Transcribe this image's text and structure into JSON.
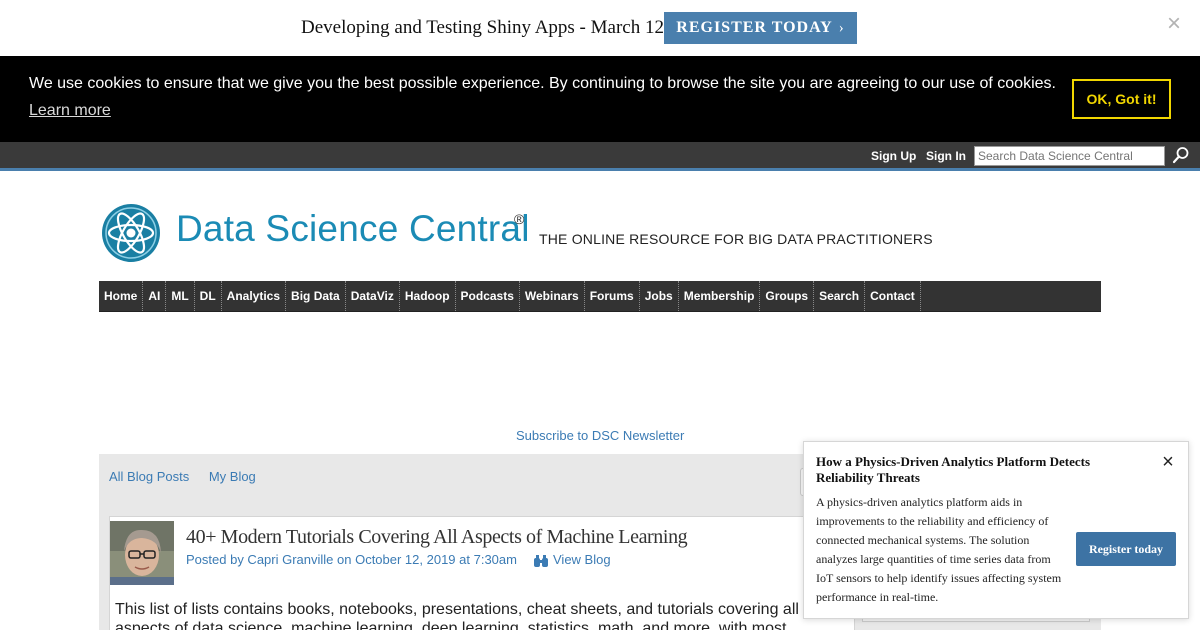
{
  "promo_banner": {
    "text": "Developing and Testing Shiny Apps - March 12",
    "button_label": "REGISTER TODAY",
    "button_chevron": "›",
    "close_glyph": "×",
    "button_color": "#4a7fad"
  },
  "cookie_bar": {
    "message": "We use cookies to ensure that we give you the best possible experience. By continuing to browse the site you are agreeing to our use of cookies.",
    "learn_more": "Learn more",
    "ok_button": "OK, Got it!",
    "accent_color": "#f1d600"
  },
  "user_bar": {
    "sign_up": "Sign Up",
    "sign_in": "Sign In",
    "search_placeholder": "Search Data Science Central",
    "search_icon": "search-icon"
  },
  "header": {
    "site_name": "Data Science Central",
    "registered_mark": "®",
    "tagline": "THE ONLINE RESOURCE FOR BIG DATA PRACTITIONERS",
    "brand_color": "#1b8bb5"
  },
  "nav": {
    "items": [
      "Home",
      "AI",
      "ML",
      "DL",
      "Analytics",
      "Big Data",
      "DataViz",
      "Hadoop",
      "Podcasts",
      "Webinars",
      "Forums",
      "Jobs",
      "Membership",
      "Groups",
      "Search",
      "Contact"
    ]
  },
  "subscribe_link": "Subscribe to DSC Newsletter",
  "blog_tabs": {
    "all_posts": "All Blog Posts",
    "my_blog": "My Blog"
  },
  "post": {
    "title": "40+ Modern Tutorials Covering All Aspects of Machine Learning",
    "meta": "Posted by Capri Granville on October 12, 2019 at 7:30am",
    "view_blog": "View Blog",
    "body": "This list of lists contains books, notebooks, presentations, cheat sheets, and tutorials covering all aspects of data science, machine learning, deep learning, statistics, math, and more, with most"
  },
  "popup": {
    "title": "How a Physics-Driven Analytics Platform Detects Reliability Threats",
    "description": "A physics-driven analytics platform aids in improvements to the reliability and efficiency of connected mechanical systems. The solution analyzes large quantities of time series data from IoT sensors to help identify issues affecting system performance in real-time.",
    "button_label": "Register today",
    "close_glyph": "×",
    "button_color": "#3d73a4"
  },
  "link_color": "#3b7bb4"
}
